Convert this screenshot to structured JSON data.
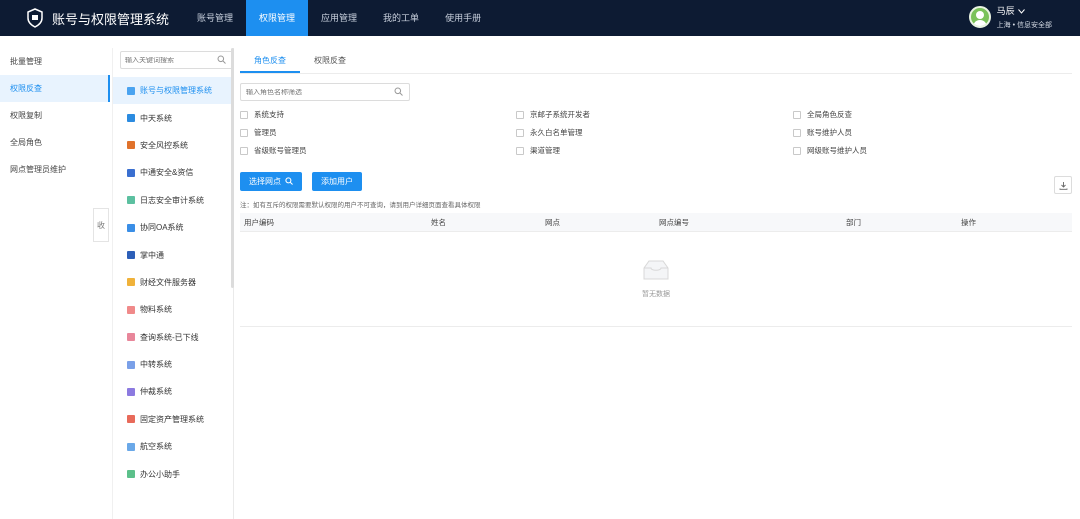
{
  "header": {
    "app_title": "账号与权限管理系统",
    "nav": [
      "账号管理",
      "权限管理",
      "应用管理",
      "我的工单",
      "使用手册"
    ],
    "active_nav": 1,
    "user_name": "马辰",
    "user_org": "上海 • 信息安全部",
    "colors": {
      "bar": "#0d1b33",
      "accent": "#1d8ff0"
    }
  },
  "leftnav": {
    "items": [
      "批量管理",
      "权限反查",
      "权限复制",
      "全局角色",
      "网点管理员维护"
    ],
    "active": 1,
    "collapse_label": "收"
  },
  "systems": {
    "search_placeholder": "输入关键词搜索",
    "items": [
      {
        "label": "账号与权限管理系统",
        "icon": "#4aa3f0"
      },
      {
        "label": "中天系统",
        "icon": "#2b8be0"
      },
      {
        "label": "安全风控系统",
        "icon": "#e0722b"
      },
      {
        "label": "中通安全&资信",
        "icon": "#3a6fd0"
      },
      {
        "label": "日志安全审计系统",
        "icon": "#5cc0a0"
      },
      {
        "label": "协同OA系统",
        "icon": "#3a8ee6"
      },
      {
        "label": "掌中通",
        "icon": "#2d5fb8"
      },
      {
        "label": "财经文件服务器",
        "icon": "#f0b23a"
      },
      {
        "label": "物料系统",
        "icon": "#f08a8a"
      },
      {
        "label": "查询系统-已下线",
        "icon": "#e8869a"
      },
      {
        "label": "中转系统",
        "icon": "#7aa0e8"
      },
      {
        "label": "仲裁系统",
        "icon": "#8c7ae0"
      },
      {
        "label": "固定资产管理系统",
        "icon": "#e86a5a"
      },
      {
        "label": "航空系统",
        "icon": "#6aa8e8"
      },
      {
        "label": "办公小助手",
        "icon": "#5cc08a"
      }
    ],
    "active": 0
  },
  "main": {
    "tabs": [
      "角色反查",
      "权限反查"
    ],
    "active_tab": 0,
    "role_search_placeholder": "输入角色名称筛选",
    "roles": [
      "系统支持",
      "京邮子系统开发者",
      "全局角色反查",
      "管理员",
      "永久白名单管理",
      "账号维护人员",
      "省级账号管理员",
      "渠道管理",
      "网级账号维护人员"
    ],
    "btn_select": "选择网点",
    "btn_add": "添加用户",
    "note": "注：如有互斥的权限需要默认权限的用户不可查询，请到用户详细页面查看具体权限",
    "columns": [
      "用户编码",
      "姓名",
      "网点",
      "网点编号",
      "部门",
      "操作"
    ],
    "empty_text": "暂无数据"
  }
}
